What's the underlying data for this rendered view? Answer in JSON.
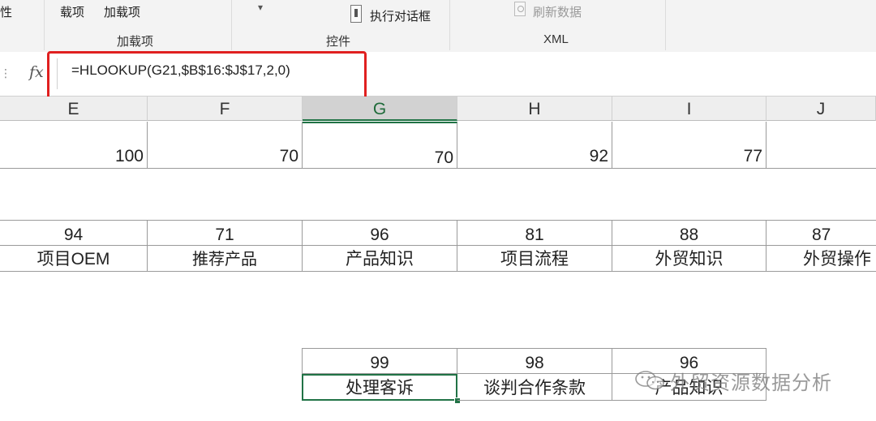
{
  "ribbon": {
    "partial_left": "性",
    "item_load": "载项",
    "item_addins": "加载项",
    "group_addins": "加载项",
    "group_controls": "控件",
    "group_xml": "XML",
    "run_dialog": "执行对话框",
    "refresh_data": "刷新数据",
    "dropdown_glyph": "▾"
  },
  "formula_bar": {
    "fx_label": "fx",
    "formula": "=HLOOKUP(G21,$B$16:$J$17,2,0)"
  },
  "columns": [
    "E",
    "F",
    "G",
    "H",
    "I",
    "J"
  ],
  "selected_column": "G",
  "rows": {
    "row_top": [
      "100",
      "70",
      "70",
      "92",
      "77",
      ""
    ],
    "table_scores": [
      "94",
      "71",
      "96",
      "81",
      "88",
      "87"
    ],
    "table_names": [
      "项目OEM",
      "推荐产品",
      "产品知识",
      "项目流程",
      "外贸知识",
      "外贸操作"
    ],
    "result_scores": [
      "99",
      "98",
      "96"
    ],
    "result_names": [
      "处理客诉",
      "谈判合作条款",
      "产品知识"
    ]
  },
  "watermark": "外贸资源数据分析",
  "colors": {
    "accent_green": "#217346",
    "highlight_red": "#e02020"
  }
}
